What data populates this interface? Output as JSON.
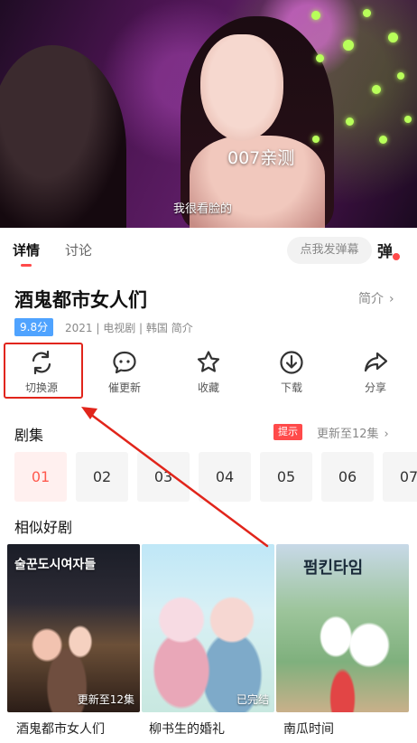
{
  "video": {
    "overlay_text": "007亲测",
    "subtitle": "我很看脸的"
  },
  "tabs": [
    {
      "label": "详情",
      "active": true
    },
    {
      "label": "讨论",
      "active": false
    }
  ],
  "danmu": {
    "placeholder": "点我发弹幕",
    "icon_text": "弹"
  },
  "show": {
    "title": "酒鬼都市女人们",
    "intro_link": "简介",
    "score": "9.8分",
    "meta": "2021 | 电视剧 | 韩国 简介"
  },
  "actions": [
    {
      "label": "切换源",
      "icon": "refresh-icon"
    },
    {
      "label": "催更新",
      "icon": "chat-bubble-icon"
    },
    {
      "label": "收藏",
      "icon": "star-icon"
    },
    {
      "label": "下载",
      "icon": "download-icon"
    },
    {
      "label": "分享",
      "icon": "share-icon"
    }
  ],
  "episodes": {
    "title": "剧集",
    "tip": "提示",
    "update": "更新至12集",
    "items": [
      "01",
      "02",
      "03",
      "04",
      "05",
      "06",
      "07"
    ]
  },
  "similar": {
    "title": "相似好剧",
    "items": [
      {
        "title": "酒鬼都市女人们",
        "status": "更新至12集",
        "logo": "술꾼도시여자들"
      },
      {
        "title": "柳书生的婚礼",
        "status": "已完结",
        "logo": ""
      },
      {
        "title": "南瓜时间",
        "status": "",
        "logo": "펌킨타임"
      }
    ]
  },
  "colors": {
    "accent": "#ff4a4a",
    "score_blue": "#4fa3ff",
    "highlight_red": "#e1251b"
  }
}
